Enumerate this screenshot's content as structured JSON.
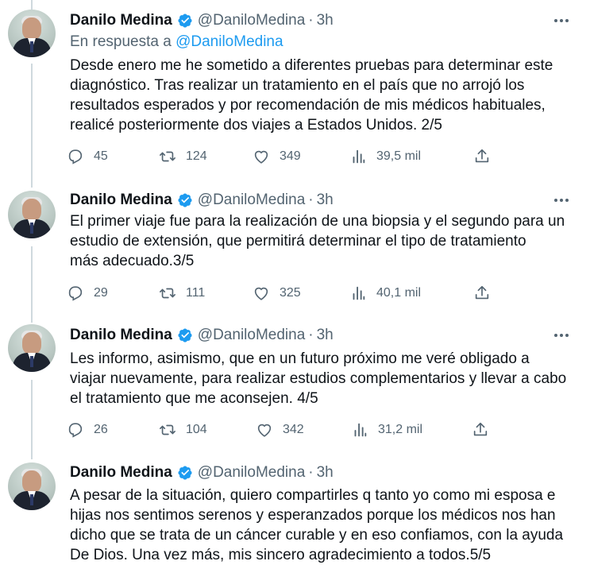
{
  "colors": {
    "text": "#0f1419",
    "secondary": "#536471",
    "accent": "#1d9bf0",
    "verified": "#1d9bf0",
    "thread_line": "#cfd9de"
  },
  "tweets": [
    {
      "author_name": "Danilo Medina",
      "handle": "@DaniloMedina",
      "separator": "·",
      "time": "3h",
      "reply_prefix": "En respuesta a",
      "reply_mention": "@DaniloMedina",
      "text": "Desde enero me he sometido a diferentes pruebas para determinar este\ndiagnóstico. Tras realizar un tratamiento en el país que no arrojó los\nresultados esperados y por recomendación de mis médicos habituales,\nrealicé posteriormente dos viajes a Estados Unidos. 2/5",
      "replies": "45",
      "retweets": "124",
      "likes": "349",
      "views": "39,5 mil"
    },
    {
      "author_name": "Danilo Medina",
      "handle": "@DaniloMedina",
      "separator": "·",
      "time": "3h",
      "text": "El primer viaje fue para la realización de una biopsia y el segundo para un\nestudio de extensión, que permitirá  determinar el tipo de tratamiento\nmás adecuado.3/5",
      "replies": "29",
      "retweets": "111",
      "likes": "325",
      "views": "40,1 mil"
    },
    {
      "author_name": "Danilo Medina",
      "handle": "@DaniloMedina",
      "separator": "·",
      "time": "3h",
      "text": "Les informo, asimismo, que en un futuro próximo me veré obligado a\nviajar nuevamente, para realizar estudios complementarios y llevar a cabo\nel tratamiento que me aconsejen. 4/5",
      "replies": "26",
      "retweets": "104",
      "likes": "342",
      "views": "31,2 mil"
    },
    {
      "author_name": "Danilo Medina",
      "handle": "@DaniloMedina",
      "separator": "·",
      "time": "3h",
      "text": "A pesar de la situación, quiero compartirles q tanto yo como mi esposa e\nhijas nos sentimos serenos y esperanzados porque los médicos nos han\ndicho que se trata de un cáncer curable y en eso confiamos, con la ayuda\nDe Dios. Una vez más, mis sincero agradecimiento a todos.5/5"
    }
  ]
}
